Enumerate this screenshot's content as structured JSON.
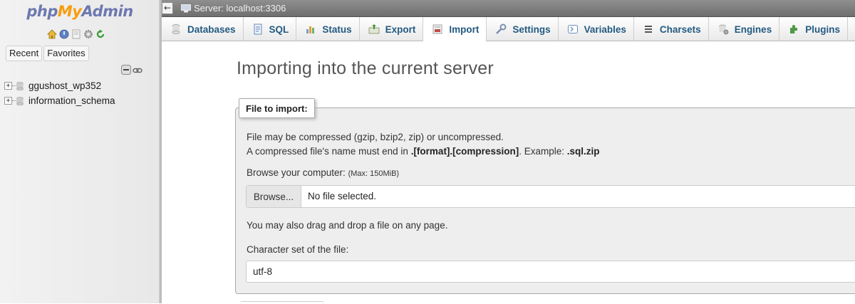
{
  "app": {
    "logo": {
      "php": "php",
      "my": "My",
      "admin": "Admin"
    }
  },
  "sidebar": {
    "quick_icons": [
      "home-icon",
      "logout-icon",
      "docs-icon",
      "settings-icon",
      "reload-icon"
    ],
    "recent_label": "Recent",
    "favorites_label": "Favorites",
    "databases": [
      {
        "name": "ggushost_wp352"
      },
      {
        "name": "information_schema"
      }
    ]
  },
  "topbar": {
    "back_symbol": "←",
    "server_label": "Server: localhost:3306"
  },
  "tabs": [
    {
      "label": "Databases",
      "icon": "database-icon"
    },
    {
      "label": "SQL",
      "icon": "sql-icon"
    },
    {
      "label": "Status",
      "icon": "status-icon"
    },
    {
      "label": "Export",
      "icon": "export-icon"
    },
    {
      "label": "Import",
      "icon": "import-icon",
      "active": true
    },
    {
      "label": "Settings",
      "icon": "wrench-icon"
    },
    {
      "label": "Variables",
      "icon": "variables-icon"
    },
    {
      "label": "Charsets",
      "icon": "charsets-icon"
    },
    {
      "label": "Engines",
      "icon": "engines-icon"
    },
    {
      "label": "Plugins",
      "icon": "plugins-icon"
    }
  ],
  "main": {
    "title": "Importing into the current server",
    "legend": "File to import:",
    "info_line1": "File may be compressed (gzip, bzip2, zip) or uncompressed.",
    "info_line2_prefix": "A compressed file's name must end in ",
    "info_line2_format": ".[format].[compression]",
    "info_line2_middle": ". Example: ",
    "info_line2_example": ".sql.zip",
    "browse_label": "Browse your computer: ",
    "browse_max": "(Max: 150MiB)",
    "browse_button": "Browse...",
    "file_status": "No file selected.",
    "drag_note": "You may also drag and drop a file on any page.",
    "charset_label": "Character set of the file:",
    "charset_value": "utf-8"
  },
  "colors": {
    "tab_text": "#235a81",
    "logo_blue": "#6c78af",
    "logo_orange": "#f89c0e"
  }
}
